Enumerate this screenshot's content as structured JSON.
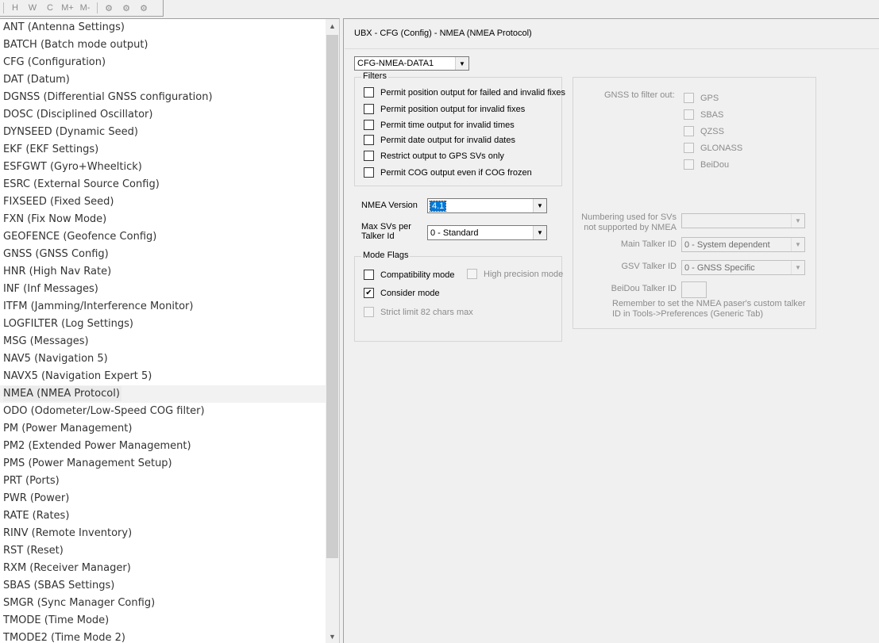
{
  "toolbar": {
    "buttons": [
      {
        "icon": "hide-columns-icon",
        "glyph": "H"
      },
      {
        "icon": "width-icon",
        "glyph": "W"
      },
      {
        "icon": "clear-icon",
        "glyph": "C"
      },
      {
        "icon": "message-add-icon",
        "glyph": "M+"
      },
      {
        "icon": "message-remove-icon",
        "glyph": "M-"
      },
      {
        "icon": "gear-icon",
        "glyph": "⚙"
      },
      {
        "icon": "gear-icon",
        "glyph": "⚙"
      },
      {
        "icon": "gear-icon",
        "glyph": "⚙"
      }
    ]
  },
  "sidebar": {
    "items": [
      {
        "label": "ANT (Antenna Settings)"
      },
      {
        "label": "BATCH (Batch mode output)"
      },
      {
        "label": "CFG (Configuration)"
      },
      {
        "label": "DAT (Datum)"
      },
      {
        "label": "DGNSS (Differential GNSS configuration)"
      },
      {
        "label": "DOSC (Disciplined Oscillator)"
      },
      {
        "label": "DYNSEED (Dynamic Seed)"
      },
      {
        "label": "EKF (EKF Settings)"
      },
      {
        "label": "ESFGWT (Gyro+Wheeltick)"
      },
      {
        "label": "ESRC (External Source Config)"
      },
      {
        "label": "FIXSEED (Fixed Seed)"
      },
      {
        "label": "FXN (Fix Now Mode)"
      },
      {
        "label": "GEOFENCE (Geofence Config)"
      },
      {
        "label": "GNSS (GNSS Config)"
      },
      {
        "label": "HNR (High Nav Rate)"
      },
      {
        "label": "INF (Inf Messages)"
      },
      {
        "label": "ITFM (Jamming/Interference Monitor)"
      },
      {
        "label": "LOGFILTER (Log Settings)"
      },
      {
        "label": "MSG (Messages)"
      },
      {
        "label": "NAV5 (Navigation 5)"
      },
      {
        "label": "NAVX5 (Navigation Expert 5)"
      },
      {
        "label": "NMEA (NMEA Protocol)"
      },
      {
        "label": "ODO (Odometer/Low-Speed COG filter)"
      },
      {
        "label": "PM (Power Management)"
      },
      {
        "label": "PM2 (Extended Power Management)"
      },
      {
        "label": "PMS (Power Management Setup)"
      },
      {
        "label": "PRT (Ports)"
      },
      {
        "label": "PWR (Power)"
      },
      {
        "label": "RATE (Rates)"
      },
      {
        "label": "RINV (Remote Inventory)"
      },
      {
        "label": "RST (Reset)"
      },
      {
        "label": "RXM (Receiver Manager)"
      },
      {
        "label": "SBAS (SBAS Settings)"
      },
      {
        "label": "SMGR (Sync Manager Config)"
      },
      {
        "label": "TMODE (Time Mode)"
      },
      {
        "label": "TMODE2 (Time Mode 2)"
      }
    ],
    "selected_index": 21
  },
  "panel": {
    "title": "UBX - CFG (Config) - NMEA (NMEA Protocol)",
    "message_select": "CFG-NMEA-DATA1",
    "filters": {
      "title": "Filters",
      "items": [
        {
          "label": "Permit position output for failed and invalid fixes",
          "checked": false
        },
        {
          "label": "Permit position output for invalid fixes",
          "checked": false
        },
        {
          "label": "Permit time output for invalid times",
          "checked": false
        },
        {
          "label": "Permit date output for invalid dates",
          "checked": false
        },
        {
          "label": "Restrict output to GPS SVs only",
          "checked": false
        },
        {
          "label": "Permit COG output even if COG frozen",
          "checked": false
        }
      ]
    },
    "nmea_version": {
      "label": "NMEA Version",
      "value": "4.1"
    },
    "max_svs": {
      "label_line1": "Max SVs per",
      "label_line2": "Talker Id",
      "value": "0 - Standard"
    },
    "mode_flags": {
      "title": "Mode Flags",
      "compatibility": {
        "label": "Compatibility mode",
        "checked": false
      },
      "high_precision": {
        "label": "High precision mode",
        "checked": false
      },
      "consider": {
        "label": "Consider mode",
        "checked": true
      },
      "strict": {
        "label": "Strict limit 82 chars max",
        "checked": false
      }
    },
    "gnss_filter": {
      "label": "GNSS to filter out:",
      "items": [
        {
          "label": "GPS",
          "checked": false
        },
        {
          "label": "SBAS",
          "checked": false
        },
        {
          "label": "QZSS",
          "checked": false
        },
        {
          "label": "GLONASS",
          "checked": false
        },
        {
          "label": "BeiDou",
          "checked": false
        }
      ]
    },
    "numbering": {
      "label_line1": "Numbering used for SVs",
      "label_line2": "not supported by NMEA",
      "value": ""
    },
    "main_talker": {
      "label": "Main Talker ID",
      "value": "0 - System dependent"
    },
    "gsv_talker": {
      "label": "GSV Talker ID",
      "value": "0 - GNSS Specific"
    },
    "beidou_talker": {
      "label": "BeiDou Talker ID",
      "value": ""
    },
    "note_line1": "Remember to set the NMEA paser's custom talker",
    "note_line2": "ID in Tools->Preferences (Generic Tab)"
  }
}
